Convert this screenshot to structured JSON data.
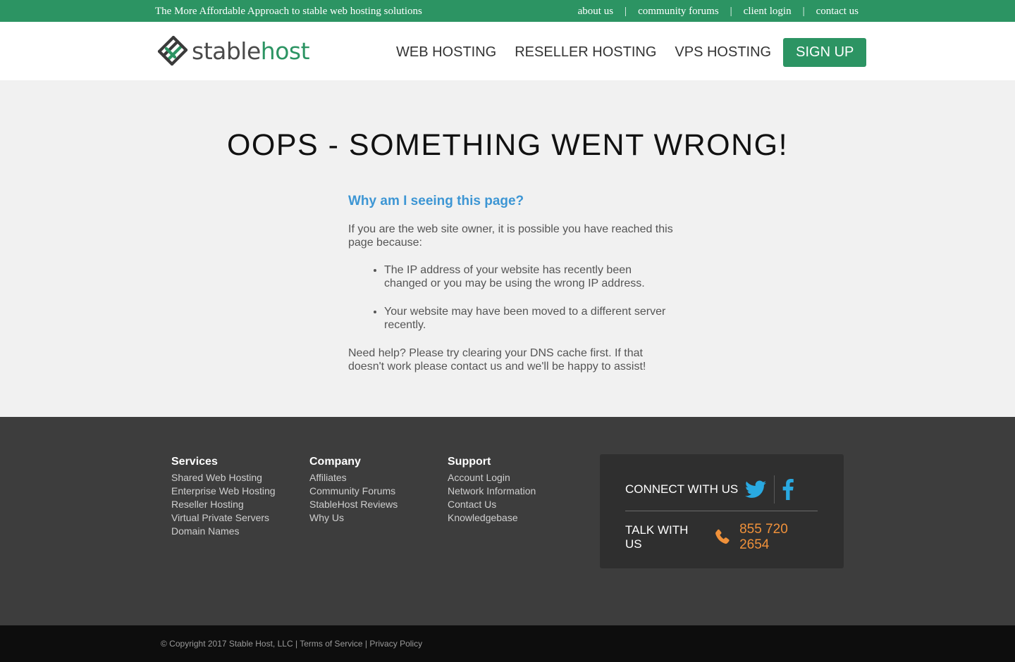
{
  "topbar": {
    "tagline": "The More Affordable Approach to stable web hosting solutions",
    "links": [
      "about us",
      "community forums",
      "client login",
      "contact us"
    ],
    "separator": "|"
  },
  "header": {
    "logo": {
      "part1": "stable",
      "part2": "host"
    },
    "nav": [
      "WEB HOSTING",
      "RESELLER HOSTING",
      "VPS HOSTING"
    ],
    "signup_label": "SIGN UP"
  },
  "main": {
    "title": "OOPS - SOMETHING WENT WRONG!",
    "subtitle": "Why am I seeing this page?",
    "intro": "If you are the web site owner, it is possible you have reached this page because:",
    "reasons": [
      "The IP address of your website has recently been changed or you may be using the wrong IP address.",
      "Your website may have been moved to a different server recently."
    ],
    "help": "Need help? Please try clearing your DNS cache first. If that doesn't work please contact us and we'll be happy to assist!"
  },
  "footer": {
    "columns": [
      {
        "heading": "Services",
        "links": [
          "Shared Web Hosting",
          "Enterprise Web Hosting",
          "Reseller Hosting",
          "Virtual Private Servers",
          "Domain Names"
        ]
      },
      {
        "heading": "Company",
        "links": [
          "Affiliates",
          "Community Forums",
          "StableHost Reviews",
          "Why Us"
        ]
      },
      {
        "heading": "Support",
        "links": [
          "Account Login",
          "Network Information",
          "Contact Us",
          "Knowledgebase"
        ]
      }
    ],
    "connect_label": "CONNECT WITH US",
    "talk_label": "TALK WITH US",
    "phone": "855 720 2654",
    "icons": [
      "twitter-icon",
      "facebook-icon",
      "phone-icon"
    ]
  },
  "bottom": {
    "copyright": "© Copyright 2017 Stable Host, LLC",
    "sep": "|",
    "terms": "Terms of Service",
    "privacy": "Privacy Policy"
  },
  "colors": {
    "brand_green": "#2c9463",
    "link_blue": "#3d96d4",
    "phone_orange": "#f0913a",
    "twitter_blue": "#29a9e1",
    "footer_bg": "#3d3d3d",
    "bottom_bg": "#0d0d0d"
  }
}
